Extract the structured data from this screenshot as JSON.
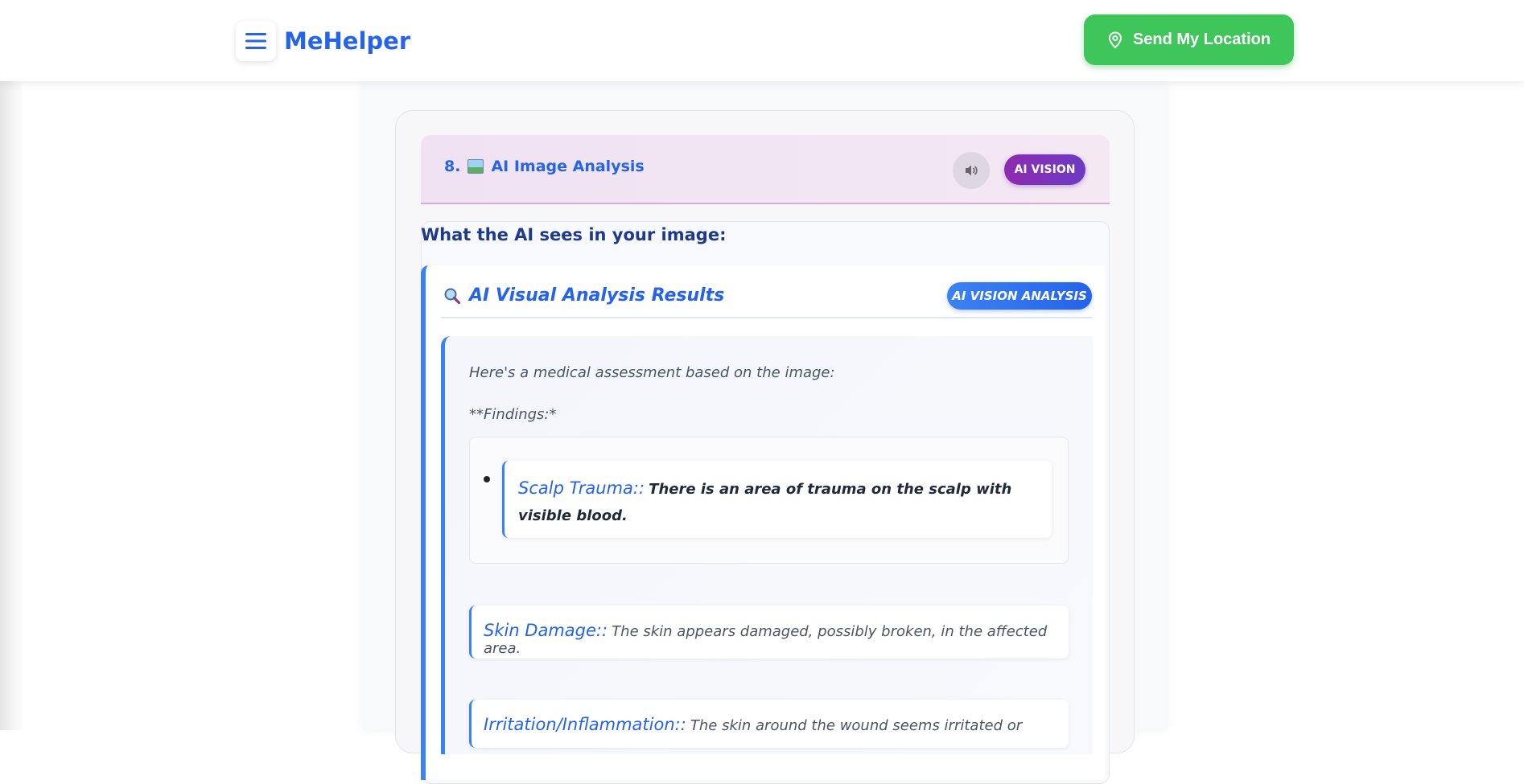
{
  "nav": {
    "brand": "MeHelper",
    "location_button": "Send My Location"
  },
  "section": {
    "number": "8.",
    "title": "AI Image Analysis",
    "badge": "AI VISION"
  },
  "sees_title": "What the AI sees in your image:",
  "results": {
    "title": "AI Visual Analysis Results",
    "badge": "AI VISION ANALYSIS",
    "intro": "Here's a medical assessment based on the image:",
    "findings_heading": "**Findings:*",
    "findings": [
      {
        "label": "Scalp Trauma::",
        "text": "There is an area of trauma on the scalp with visible blood."
      },
      {
        "label": "Skin Damage::",
        "text": "The skin appears damaged, possibly broken, in the affected area."
      },
      {
        "label": "Irritation/Inflammation::",
        "text": "The skin around the wound seems irritated or"
      }
    ]
  },
  "icons": {
    "menu": "hamburger-menu-icon",
    "location": "map-pin-icon",
    "image": "picture-icon",
    "speaker": "speaker-icon",
    "magnifier": "magnifier-icon"
  },
  "colors": {
    "brand": "#2563eb",
    "location_button": "#3ec65a",
    "vision_badge": "#8e2bb0",
    "accent_border": "#3b82f6"
  }
}
